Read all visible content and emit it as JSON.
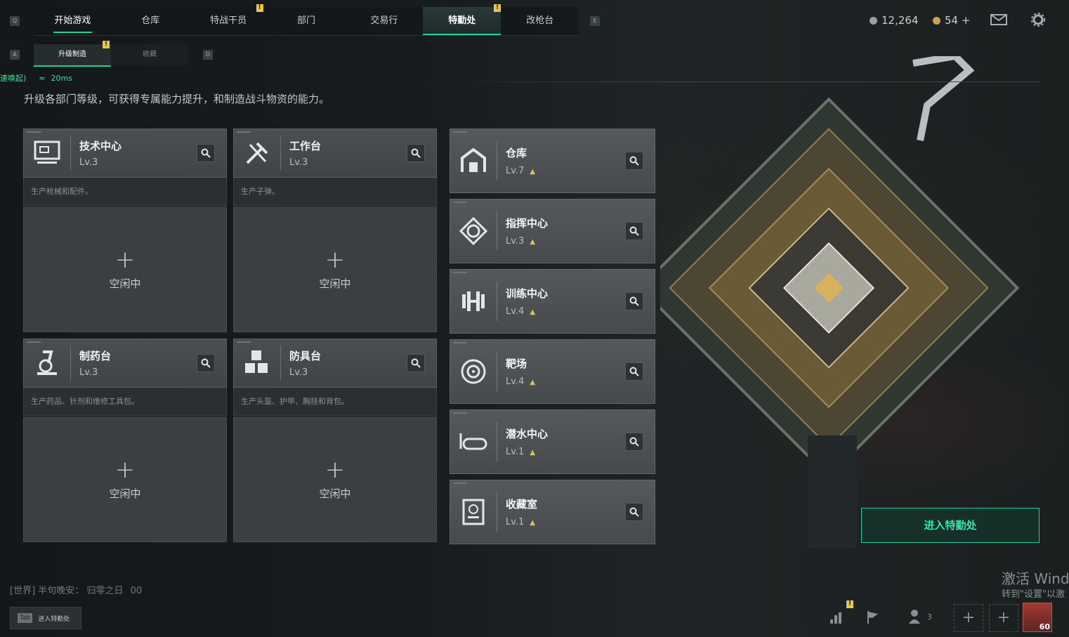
{
  "topbar": {
    "key_left": "Q",
    "key_right": "E",
    "tabs": [
      {
        "label": "开始游戏"
      },
      {
        "label": "仓库"
      },
      {
        "label": "特战干员",
        "badge": "!"
      },
      {
        "label": "部门"
      },
      {
        "label": "交易行"
      },
      {
        "label": "特勤处",
        "badge": "!"
      },
      {
        "label": "改枪台"
      }
    ],
    "currency1": "12,264",
    "currency2": "54 +"
  },
  "subnav": {
    "key_left": "A",
    "key_right": "D",
    "tabs": [
      {
        "label": "升级制造",
        "badge": "!"
      },
      {
        "label": "收藏"
      }
    ]
  },
  "status": {
    "prefix": "速唤起)",
    "ping": "20ms"
  },
  "intro": "升级各部门等级，可获得专属能力提升，和制造战斗物资的能力。",
  "workshops": [
    {
      "name": "技术中心",
      "level": "Lv.3",
      "desc": "生产枪械和配件。",
      "state": "空闲中",
      "icon": "monitor-icon"
    },
    {
      "name": "工作台",
      "level": "Lv.3",
      "desc": "生产子弹。",
      "state": "空闲中",
      "icon": "tools-icon"
    },
    {
      "name": "制药台",
      "level": "Lv.3",
      "desc": "生产药品、针剂和维修工具包。",
      "state": "空闲中",
      "icon": "microscope-icon"
    },
    {
      "name": "防具台",
      "level": "Lv.3",
      "desc": "生产头盔、护甲、胸挂和背包。",
      "state": "空闲中",
      "icon": "cubes-icon"
    }
  ],
  "facilities": [
    {
      "name": "仓库",
      "level": "Lv.7",
      "icon": "warehouse-icon"
    },
    {
      "name": "指挥中心",
      "level": "Lv.3",
      "icon": "command-icon"
    },
    {
      "name": "训练中心",
      "level": "Lv.4",
      "icon": "dumbbell-icon"
    },
    {
      "name": "靶场",
      "level": "Lv.4",
      "icon": "target-icon"
    },
    {
      "name": "潜水中心",
      "level": "Lv.1",
      "icon": "diving-mask-icon"
    },
    {
      "name": "收藏室",
      "level": "Lv.1",
      "icon": "collection-icon"
    }
  ],
  "enter_button": "进入特勤处",
  "chat": {
    "channel": "[世界]",
    "name": "半句晚安",
    "sep": "：",
    "message": "归零之日",
    "tail": "00"
  },
  "hint": {
    "key": "Tab",
    "text": "进入特勤处"
  },
  "watermark": {
    "line1": "激活 Wind",
    "line2": "转到\"设置\"以激"
  },
  "bottom_bar": {
    "friends_count": "3",
    "level_badge": "60"
  }
}
